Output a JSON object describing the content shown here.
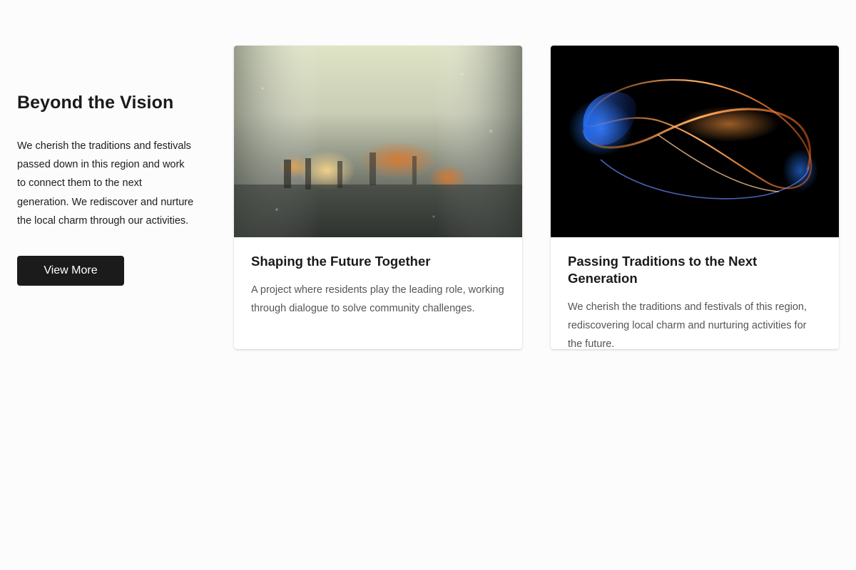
{
  "intro": {
    "title": "Beyond the Vision",
    "text": "We cherish the traditions and festivals passed down in this region and work to connect them to the next generation. We rediscover and nurture the local charm through our activities.",
    "button_label": "View More"
  },
  "cards": [
    {
      "title": "Shaping the Future Together",
      "description": "A project where residents play the leading role, working through dialogue to solve community challenges."
    },
    {
      "title": "Passing Traditions to the Next Generation",
      "description": "We cherish the traditions and festivals of this region, rediscovering local charm and nurturing activities for the future."
    }
  ]
}
